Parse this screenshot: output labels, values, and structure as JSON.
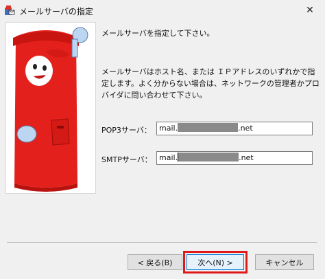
{
  "window": {
    "title": "メールサーバの指定",
    "close_glyph": "✕"
  },
  "content": {
    "heading": "メールサーバを指定して下さい。",
    "description": "メールサーバはホスト名、または ＩＰアドレスのいずれかで指定します。よく分からない場合は、ネットワークの管理者かプロバイダに問い合わせて下さい。"
  },
  "fields": {
    "pop3": {
      "label": "POP3サーバ：",
      "prefix": "mail.",
      "suffix": ".net"
    },
    "smtp": {
      "label": "SMTPサーバ：",
      "prefix": "mail.",
      "suffix": ".net"
    }
  },
  "buttons": {
    "back": "< 戻る(B)",
    "next": "次へ(N) >",
    "cancel": "キャンセル"
  },
  "colors": {
    "accent": "#0078d7",
    "highlight": "#e01a1a",
    "mailbox_red": "#e3201b"
  },
  "icons": {
    "app": "app-icon",
    "close": "close-icon",
    "illustration": "mailbox-mascot"
  }
}
